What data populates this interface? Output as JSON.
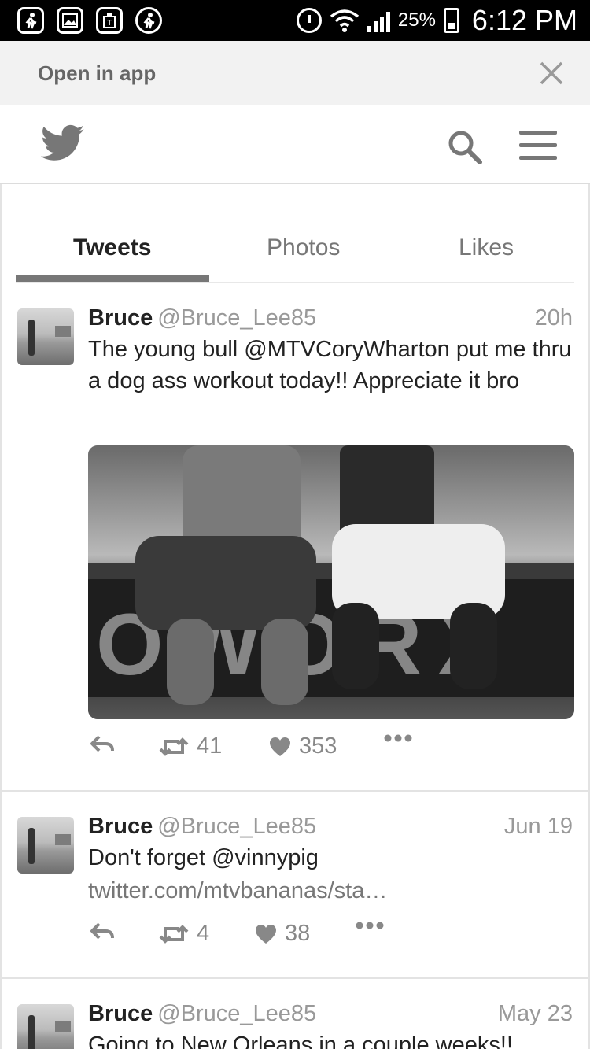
{
  "status_bar": {
    "battery": "25%",
    "time": "6:12 PM"
  },
  "open_in_app": {
    "label": "Open in app"
  },
  "tabs": [
    {
      "label": "Tweets",
      "active": true
    },
    {
      "label": "Photos",
      "active": false
    },
    {
      "label": "Likes",
      "active": false
    }
  ],
  "tweets": [
    {
      "name": "Bruce",
      "handle": "@Bruce_Lee85",
      "time": "20h",
      "text": "The young bull @MTVCoryWharton put me thru a dog ass workout today!! Appreciate it bro",
      "retweets": "41",
      "likes": "353"
    },
    {
      "name": "Bruce",
      "handle": "@Bruce_Lee85",
      "time": "Jun 19",
      "text": "Don't forget @vinnypig",
      "link": "twitter.com/mtvbananas/sta…",
      "retweets": "4",
      "likes": "38"
    },
    {
      "name": "Bruce",
      "handle": "@Bruce_Lee85",
      "time": "May 23",
      "text": "Going to New Orleans in a couple weeks!!"
    }
  ],
  "colors": {
    "text": "#222222",
    "muted": "#999999",
    "icon": "#777777",
    "status_bar": "#000000",
    "banner": "#f2f2f2"
  }
}
